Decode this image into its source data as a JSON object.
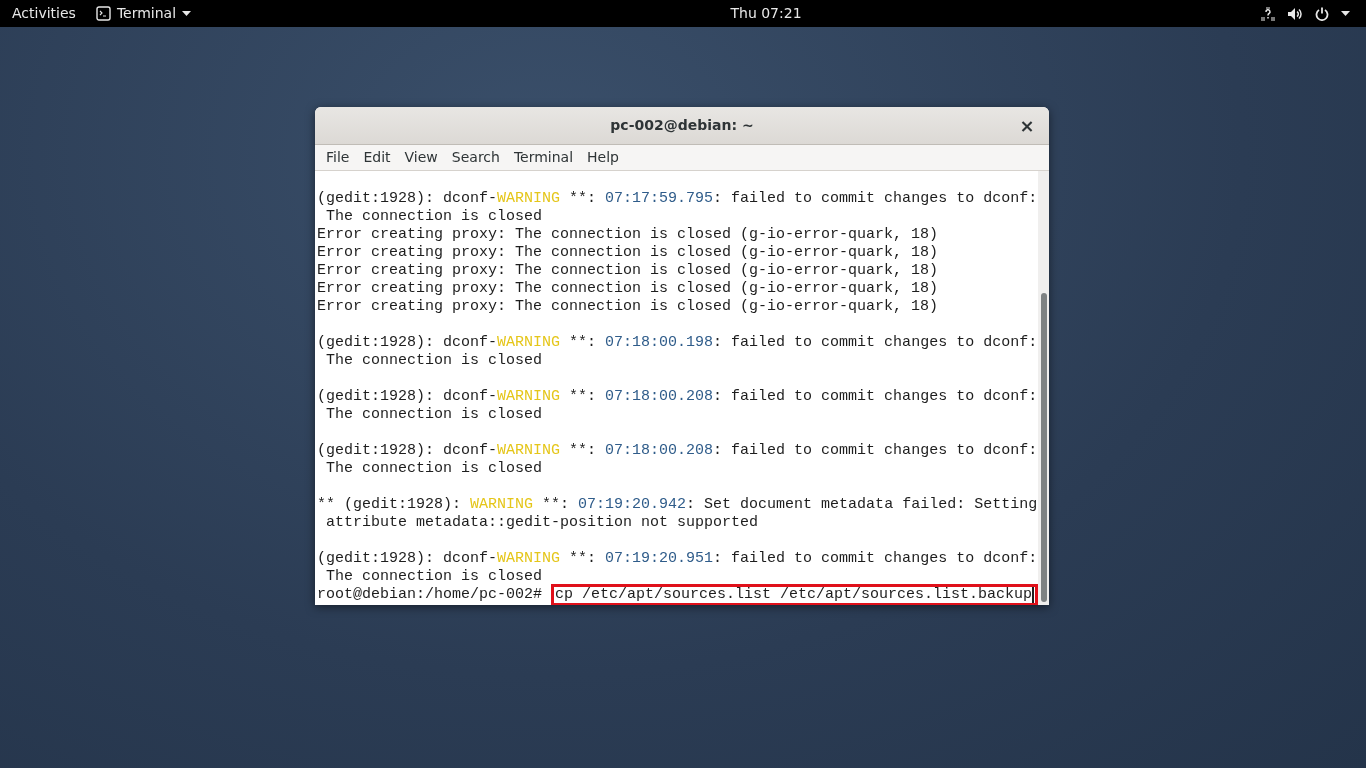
{
  "top_bar": {
    "activities": "Activities",
    "app_menu": "Terminal",
    "clock": "Thu 07:21"
  },
  "window": {
    "title": "pc-002@debian: ~",
    "close": "×"
  },
  "menu": [
    {
      "label": "File"
    },
    {
      "label": "Edit"
    },
    {
      "label": "View"
    },
    {
      "label": "Search"
    },
    {
      "label": "Terminal"
    },
    {
      "label": "Help"
    }
  ],
  "terminal": {
    "lines": [
      {
        "kind": "text",
        "segments": [
          {
            "kind": "plain",
            "text": "(gedit:1928): dconf-"
          },
          {
            "kind": "warning",
            "text": "WARNING"
          },
          {
            "kind": "plain",
            "text": " **: "
          },
          {
            "kind": "time",
            "text": "07:17:59.795"
          },
          {
            "kind": "plain",
            "text": ": failed to commit changes to dconf:"
          }
        ]
      },
      {
        "kind": "text",
        "segments": [
          {
            "kind": "plain",
            "text": " The connection is closed"
          }
        ]
      },
      {
        "kind": "text",
        "segments": [
          {
            "kind": "plain",
            "text": "Error creating proxy: The connection is closed (g-io-error-quark, 18)"
          }
        ]
      },
      {
        "kind": "text",
        "segments": [
          {
            "kind": "plain",
            "text": "Error creating proxy: The connection is closed (g-io-error-quark, 18)"
          }
        ]
      },
      {
        "kind": "text",
        "segments": [
          {
            "kind": "plain",
            "text": "Error creating proxy: The connection is closed (g-io-error-quark, 18)"
          }
        ]
      },
      {
        "kind": "text",
        "segments": [
          {
            "kind": "plain",
            "text": "Error creating proxy: The connection is closed (g-io-error-quark, 18)"
          }
        ]
      },
      {
        "kind": "text",
        "segments": [
          {
            "kind": "plain",
            "text": "Error creating proxy: The connection is closed (g-io-error-quark, 18)"
          }
        ]
      },
      {
        "kind": "blank"
      },
      {
        "kind": "text",
        "segments": [
          {
            "kind": "plain",
            "text": "(gedit:1928): dconf-"
          },
          {
            "kind": "warning",
            "text": "WARNING"
          },
          {
            "kind": "plain",
            "text": " **: "
          },
          {
            "kind": "time",
            "text": "07:18:00.198"
          },
          {
            "kind": "plain",
            "text": ": failed to commit changes to dconf:"
          }
        ]
      },
      {
        "kind": "text",
        "segments": [
          {
            "kind": "plain",
            "text": " The connection is closed"
          }
        ]
      },
      {
        "kind": "blank"
      },
      {
        "kind": "text",
        "segments": [
          {
            "kind": "plain",
            "text": "(gedit:1928): dconf-"
          },
          {
            "kind": "warning",
            "text": "WARNING"
          },
          {
            "kind": "plain",
            "text": " **: "
          },
          {
            "kind": "time",
            "text": "07:18:00.208"
          },
          {
            "kind": "plain",
            "text": ": failed to commit changes to dconf:"
          }
        ]
      },
      {
        "kind": "text",
        "segments": [
          {
            "kind": "plain",
            "text": " The connection is closed"
          }
        ]
      },
      {
        "kind": "blank"
      },
      {
        "kind": "text",
        "segments": [
          {
            "kind": "plain",
            "text": "(gedit:1928): dconf-"
          },
          {
            "kind": "warning",
            "text": "WARNING"
          },
          {
            "kind": "plain",
            "text": " **: "
          },
          {
            "kind": "time",
            "text": "07:18:00.208"
          },
          {
            "kind": "plain",
            "text": ": failed to commit changes to dconf:"
          }
        ]
      },
      {
        "kind": "text",
        "segments": [
          {
            "kind": "plain",
            "text": " The connection is closed"
          }
        ]
      },
      {
        "kind": "blank"
      },
      {
        "kind": "text",
        "segments": [
          {
            "kind": "plain",
            "text": "** (gedit:1928): "
          },
          {
            "kind": "warning",
            "text": "WARNING"
          },
          {
            "kind": "plain",
            "text": " **: "
          },
          {
            "kind": "time",
            "text": "07:19:20.942"
          },
          {
            "kind": "plain",
            "text": ": Set document metadata failed: Setting"
          }
        ]
      },
      {
        "kind": "text",
        "segments": [
          {
            "kind": "plain",
            "text": " attribute metadata::gedit-position not supported"
          }
        ]
      },
      {
        "kind": "blank"
      },
      {
        "kind": "text",
        "segments": [
          {
            "kind": "plain",
            "text": "(gedit:1928): dconf-"
          },
          {
            "kind": "warning",
            "text": "WARNING"
          },
          {
            "kind": "plain",
            "text": " **: "
          },
          {
            "kind": "time",
            "text": "07:19:20.951"
          },
          {
            "kind": "plain",
            "text": ": failed to commit changes to dconf:"
          }
        ]
      },
      {
        "kind": "text",
        "segments": [
          {
            "kind": "plain",
            "text": " The connection is closed"
          }
        ]
      },
      {
        "kind": "prompt",
        "prompt": "root@debian:/home/pc-002#",
        "command": "cp /etc/apt/sources.list /etc/apt/sources.list.backup",
        "highlighted": true
      }
    ]
  }
}
